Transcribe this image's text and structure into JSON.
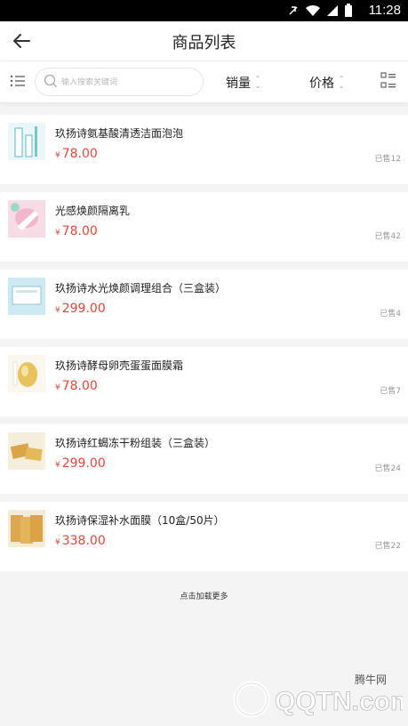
{
  "status_bar": {
    "time": "11:28"
  },
  "header": {
    "title": "商品列表"
  },
  "filter": {
    "search_placeholder": "输入搜索关键词",
    "sort_sales": "销量",
    "sort_price": "价格"
  },
  "products": [
    {
      "name": "玖扬诗氨基酸清透洁面泡泡",
      "price": "78.00",
      "currency": "¥",
      "sold": "已售12"
    },
    {
      "name": "光感焕颜隔离乳",
      "price": "78.00",
      "currency": "¥",
      "sold": "已售42"
    },
    {
      "name": "玖扬诗水光焕颜调理组合（三盒装）",
      "price": "299.00",
      "currency": "¥",
      "sold": "已售4"
    },
    {
      "name": "玖扬诗酵母卵壳蛋蛋面膜霜",
      "price": "78.00",
      "currency": "¥",
      "sold": "已售7"
    },
    {
      "name": "玖扬诗红蝎冻干粉组装（三盒装）",
      "price": "299.00",
      "currency": "¥",
      "sold": "已售24"
    },
    {
      "name": "玖扬诗保湿补水面膜（10盒/50片）",
      "price": "338.00",
      "currency": "¥",
      "sold": "已售22"
    }
  ],
  "load_more": "点击加载更多",
  "watermark": {
    "text_cn": "腾牛网",
    "text_en": "QQTN.com"
  },
  "colors": {
    "price": "#e2473c",
    "text": "#222222",
    "muted": "#999999",
    "background": "#f4f4f4"
  }
}
